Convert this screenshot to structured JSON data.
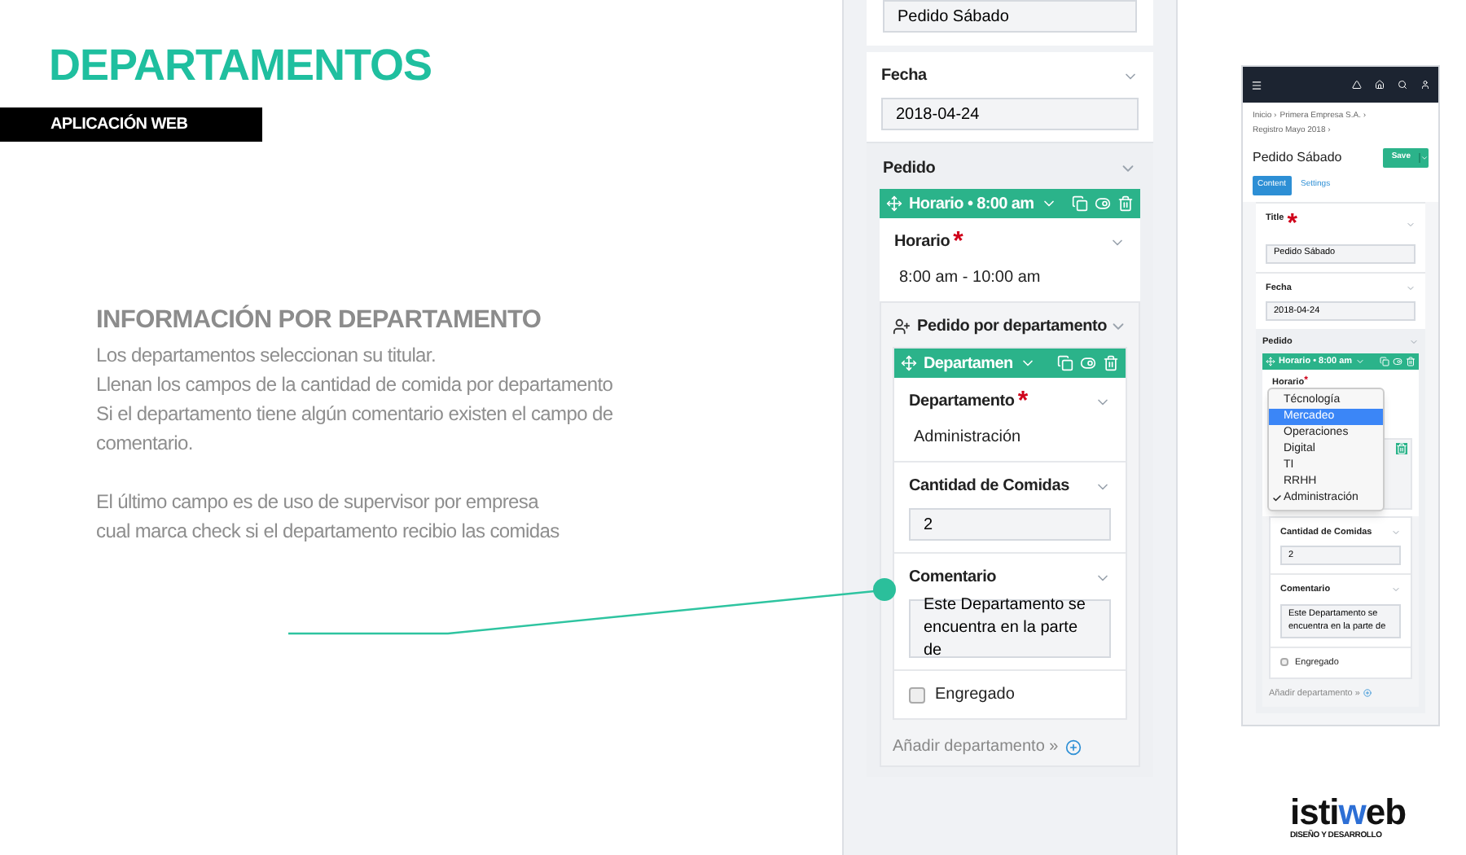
{
  "slide": {
    "title": "DEPARTAMENTOS",
    "subtitle": "APLICACIÓN WEB",
    "heading": "INFORMACIÓN POR DEPARTAMENTO",
    "paragraphs": [
      [
        "Los departamentos seleccionan su titular.",
        "Llenan los campos de la cantidad de comida por departamento",
        "Si el departamento tiene algún comentario existen el campo de",
        "comentario."
      ],
      [
        "El último campo es de uso de supervisor por empresa",
        "cual marca check si el departamento recibio las comidas"
      ]
    ]
  },
  "large_view": {
    "top_field": {
      "value": "Pedido Sábado"
    },
    "fecha": {
      "kind": "input",
      "label": "Fecha",
      "value": "2018-04-24"
    },
    "pedido": {
      "label": "Pedido",
      "block_bar": "Horario • 8:00 am",
      "horario": {
        "kind": "text",
        "label": "Horario",
        "required_mark": "*",
        "value": "8:00 am - 10:00 am"
      },
      "group": {
        "label": "Pedido por departamento",
        "block_bar": "Departamen",
        "fields": [
          {
            "kind": "text",
            "label": "Departamento",
            "required_mark": "*",
            "value": "Administración"
          },
          {
            "kind": "input",
            "label": "Cantidad de Comidas",
            "value": "2"
          },
          {
            "kind": "textarea",
            "label": "Comentario",
            "value": "Este Departamento se encuentra en la parte de"
          },
          {
            "kind": "checkbox",
            "label": "Engregado",
            "checked": false
          }
        ],
        "add_link": "Añadir departamento »"
      }
    }
  },
  "small_view": {
    "breadcrumb": [
      "Inicio ›",
      "Primera Empresa S.A. ›",
      "Registro Mayo 2018 ›"
    ],
    "page_title": "Pedido Sábado",
    "save_button": "Save",
    "tabs": [
      {
        "label": "Content",
        "selected": true
      },
      {
        "label": "Settings",
        "selected": false
      }
    ],
    "title_field": {
      "kind": "input",
      "label": "Title",
      "required_mark": "*",
      "value": "Pedido Sábado"
    },
    "fecha": {
      "kind": "input",
      "label": "Fecha",
      "value": "2018-04-24"
    },
    "pedido": {
      "label": "Pedido",
      "block_bar": "Horario • 8:00 am",
      "horario_label": "Horario",
      "horario_required_mark": "*",
      "dropdown": [
        {
          "label": "Técnología",
          "selected": false,
          "checked": false
        },
        {
          "label": "Mercadeo",
          "selected": true,
          "checked": false
        },
        {
          "label": "Operaciones",
          "selected": false,
          "checked": false
        },
        {
          "label": "Digital",
          "selected": false,
          "checked": false
        },
        {
          "label": "TI",
          "selected": false,
          "checked": false
        },
        {
          "label": "RRHH",
          "selected": false,
          "checked": false
        },
        {
          "label": "Administración",
          "selected": false,
          "checked": true
        }
      ],
      "fields": [
        {
          "kind": "input",
          "label": "Cantidad de Comidas",
          "value": "2"
        },
        {
          "kind": "textarea",
          "label": "Comentario",
          "value": "Este Departamento se encuentra en la parte de"
        },
        {
          "kind": "checkbox",
          "label": "Engregado",
          "checked": false
        }
      ],
      "add_link": "Añadir departamento »"
    }
  },
  "logo": {
    "parts": [
      {
        "text": "isti",
        "accent": false
      },
      {
        "text": "w",
        "accent": true
      },
      {
        "text": "eb",
        "accent": false
      }
    ],
    "tagline": "DISEÑO Y DESARROLLO"
  }
}
